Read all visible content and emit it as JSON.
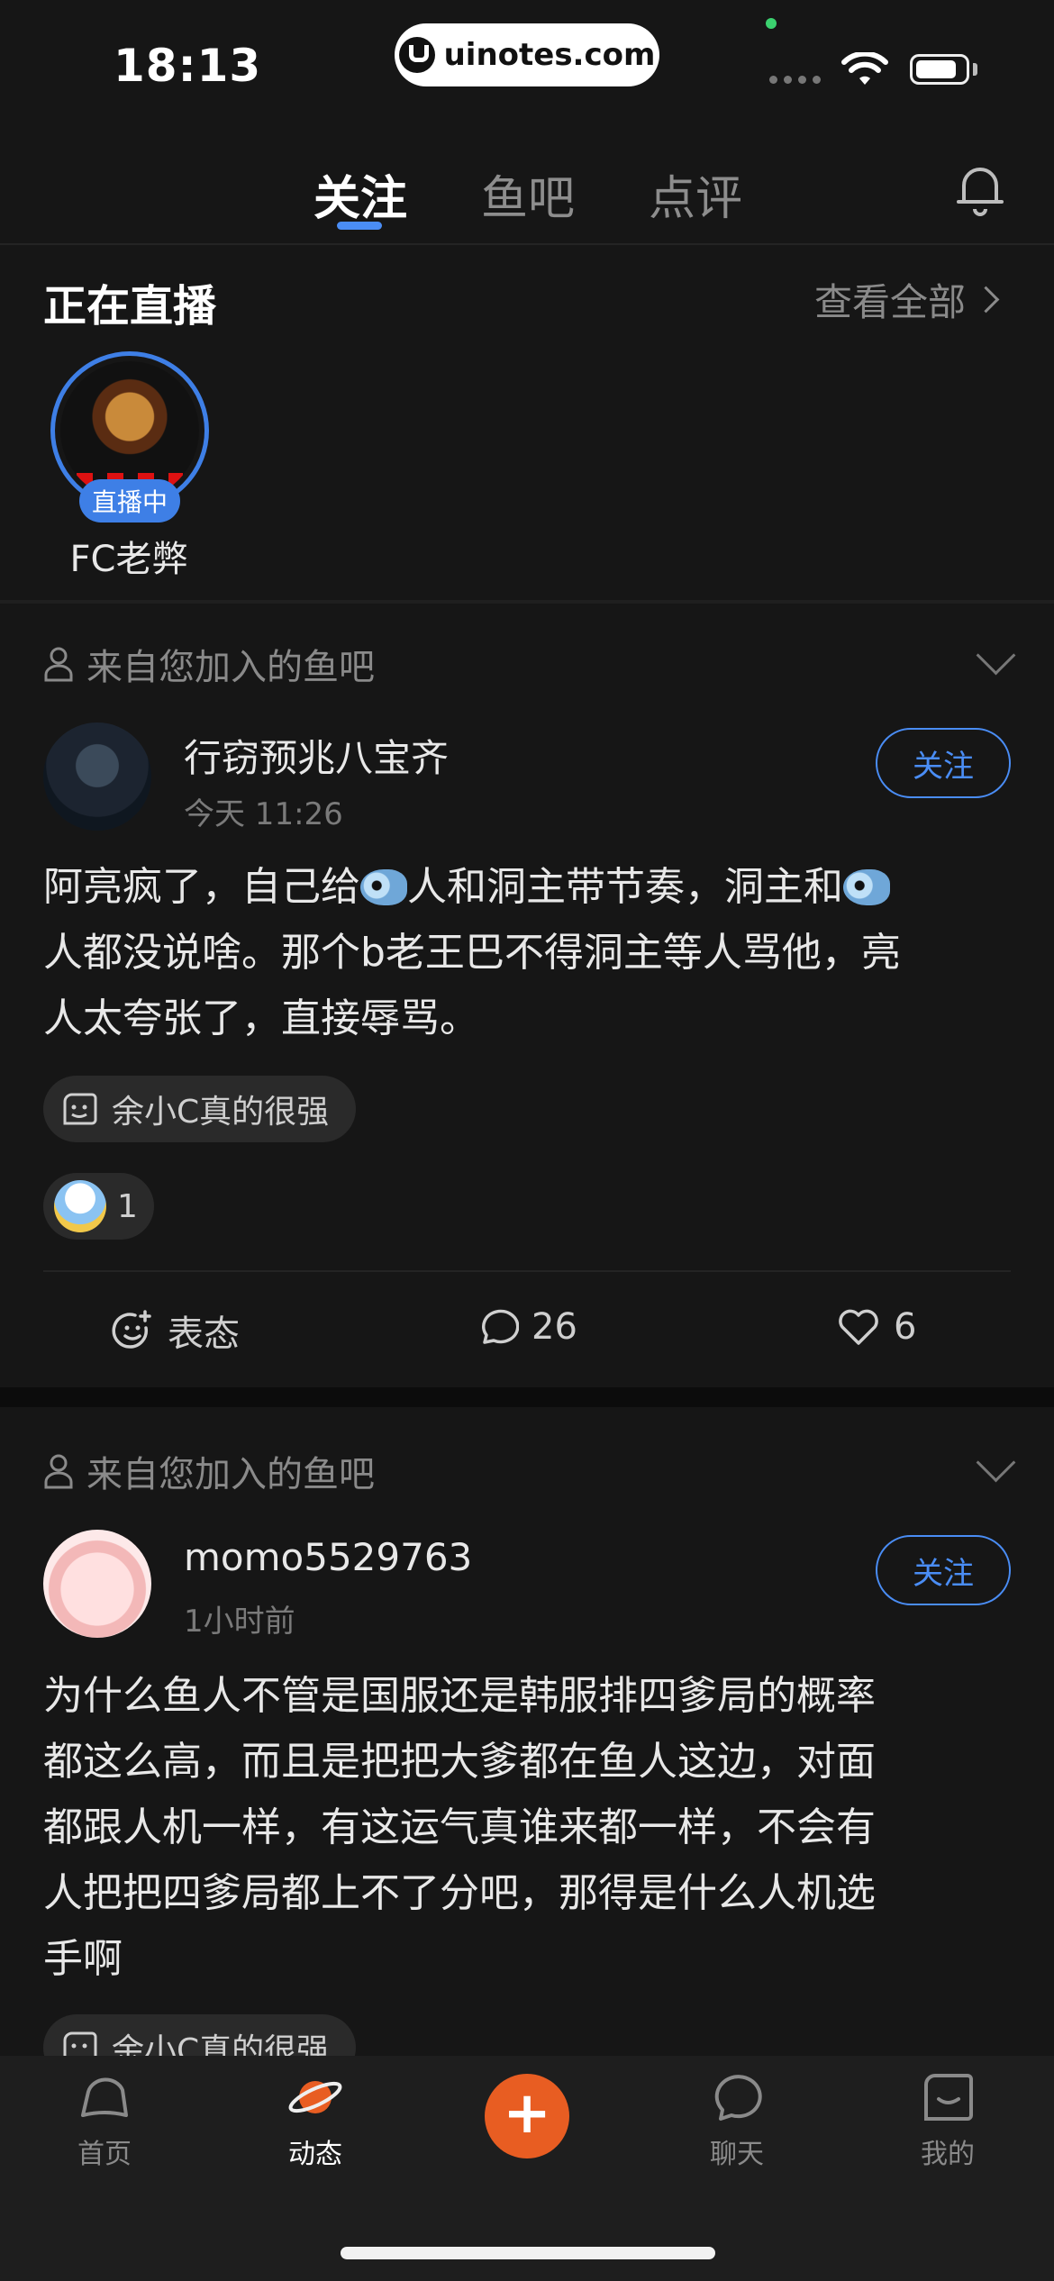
{
  "status_bar": {
    "time": "18:13",
    "url": "uinotes.com"
  },
  "tabs": [
    {
      "label": "关注",
      "active": true
    },
    {
      "label": "鱼吧",
      "active": false
    },
    {
      "label": "点评",
      "active": false
    }
  ],
  "live": {
    "title": "正在直播",
    "see_all": "查看全部",
    "streamer": {
      "name": "FC老弊",
      "badge": "直播中"
    }
  },
  "posts": [
    {
      "source": "来自您加入的鱼吧",
      "username": "行窃预兆八宝齐",
      "time": "今天 11:26",
      "follow_label": "关注",
      "body_lines": [
        [
          "阿亮疯了，自己给",
          "人和洞主带节奏，洞主和",
          ""
        ],
        [
          "人都没说啥。那个b老王巴不得洞主等人骂他，亮"
        ],
        [
          "人太夸张了，直接辱骂。"
        ]
      ],
      "tag": "余小C真的很强",
      "reaction_count": "1",
      "actions": {
        "react": "表态",
        "comments": "26",
        "likes": "6"
      }
    },
    {
      "source": "来自您加入的鱼吧",
      "username": "momo5529763",
      "time": "1小时前",
      "follow_label": "关注",
      "body_lines": [
        "为什么鱼人不管是国服还是韩服排四爹局的概率",
        "都这么高，而且是把把大爹都在鱼人这边，对面",
        "都跟人机一样，有这运气真谁来都一样，不会有",
        "人把把四爹局都上不了分吧，那得是什么人机选",
        "手啊"
      ],
      "tag": "余小C真的很强"
    }
  ],
  "bottom_nav": {
    "items": [
      {
        "label": "首页",
        "icon": "home-icon"
      },
      {
        "label": "动态",
        "icon": "planet-icon"
      },
      {
        "label": "聊天",
        "icon": "chat-icon"
      },
      {
        "label": "我的",
        "icon": "profile-icon"
      }
    ],
    "add_icon": "plus-icon"
  },
  "colors": {
    "accent": "#4a8df5",
    "add_button": "#e85d22",
    "background": "#161616"
  }
}
